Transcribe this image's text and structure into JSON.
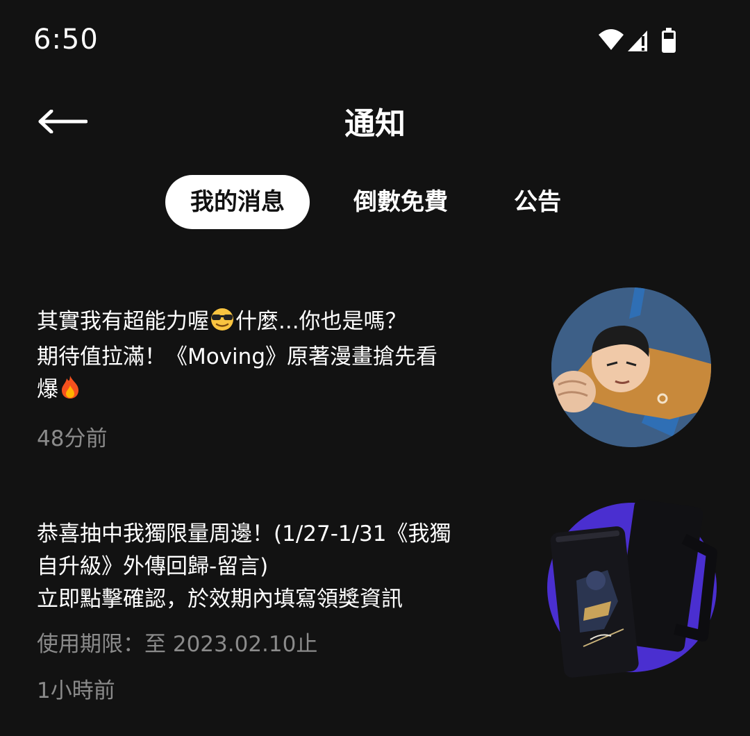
{
  "status_bar": {
    "time": "6:50",
    "icons": [
      "wifi-icon",
      "cellular-signal-icon",
      "battery-icon"
    ]
  },
  "header": {
    "back_icon": "arrow-left-icon",
    "title": "通知"
  },
  "tabs": [
    {
      "label": "我的消息",
      "active": true
    },
    {
      "label": "倒數免費",
      "active": false
    },
    {
      "label": "公告",
      "active": false
    }
  ],
  "notifications": [
    {
      "lines": [
        {
          "before": "其實我有超能力喔",
          "emoji": "sunglasses-emoji",
          "after": "什麼...你也是嗎？"
        },
        {
          "text": "期待值拉滿！《Moving》原著漫畫搶先看"
        },
        {
          "before": "爆",
          "emoji": "fire-emoji",
          "after": ""
        }
      ],
      "time": "48分前",
      "thumbnail": "moving-comic-character"
    },
    {
      "lines": [
        {
          "text": "恭喜抽中我獨限量周邊！(1/27-1/31《我獨"
        },
        {
          "text": "自升級》外傳回歸-留言)"
        },
        {
          "text": "立即點擊確認，於效期內填寫領獎資訊"
        }
      ],
      "expiry": "使用期限：至 2023.02.10止",
      "time": "1小時前",
      "thumbnail": "solo-leveling-mug"
    }
  ],
  "colors": {
    "background": "#121212",
    "text_primary": "#ffffff",
    "text_secondary": "#8b8b8b",
    "tab_active_bg": "#ffffff",
    "tab_active_text": "#111111",
    "accent_purple": "#4a2fd0"
  }
}
